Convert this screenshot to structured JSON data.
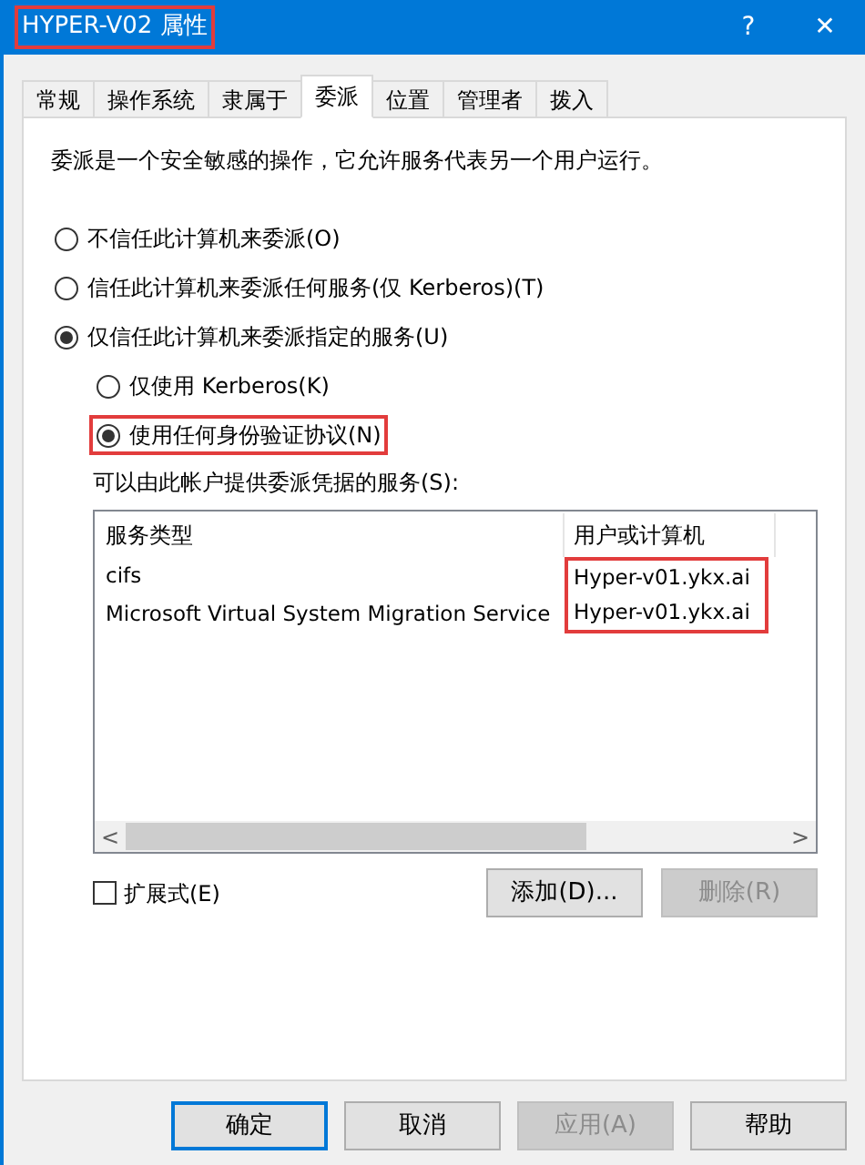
{
  "window": {
    "title": "HYPER-V02 属性",
    "title_highlighted": true,
    "help": "?",
    "close": "✕"
  },
  "tabs": [
    {
      "label": "常规",
      "selected": false
    },
    {
      "label": "操作系统",
      "selected": false
    },
    {
      "label": "隶属于",
      "selected": false
    },
    {
      "label": "委派",
      "selected": true
    },
    {
      "label": "位置",
      "selected": false
    },
    {
      "label": "管理者",
      "selected": false
    },
    {
      "label": "拨入",
      "selected": false
    }
  ],
  "description": "委派是一个安全敏感的操作，它允许服务代表另一个用户运行。",
  "options": [
    {
      "label": "不信任此计算机来委派(O)",
      "selected": false,
      "highlighted": false
    },
    {
      "label": "信任此计算机来委派任何服务(仅 Kerberos)(T)",
      "selected": false,
      "highlighted": false
    },
    {
      "label": "仅信任此计算机来委派指定的服务(U)",
      "selected": true,
      "highlighted": false,
      "children": [
        {
          "label": "仅使用 Kerberos(K)",
          "selected": false,
          "highlighted": false
        },
        {
          "label": "使用任何身份验证协议(N)",
          "selected": true,
          "highlighted": true
        }
      ]
    }
  ],
  "services_label": "可以由此帐户提供委派凭据的服务(S):",
  "table": {
    "columns": [
      {
        "label": "服务类型"
      },
      {
        "label": "用户或计算机"
      }
    ],
    "rows": [
      {
        "service": "cifs",
        "host": "Hyper-v01.ykx.ai",
        "host_highlighted": true
      },
      {
        "service": "Microsoft Virtual System Migration Service",
        "host": "Hyper-v01.ykx.ai",
        "host_highlighted": true
      }
    ],
    "scroll_left": "<",
    "scroll_right": ">"
  },
  "expanded": {
    "label": "扩展式(E)",
    "checked": false
  },
  "list_buttons": [
    {
      "label": "添加(D)...",
      "disabled": false
    },
    {
      "label": "删除(R)",
      "disabled": true
    }
  ],
  "buttons": [
    {
      "label": "确定",
      "disabled": false,
      "default": true
    },
    {
      "label": "取消",
      "disabled": false,
      "default": false
    },
    {
      "label": "应用(A)",
      "disabled": true,
      "default": false
    },
    {
      "label": "帮助",
      "disabled": false,
      "default": false
    }
  ]
}
